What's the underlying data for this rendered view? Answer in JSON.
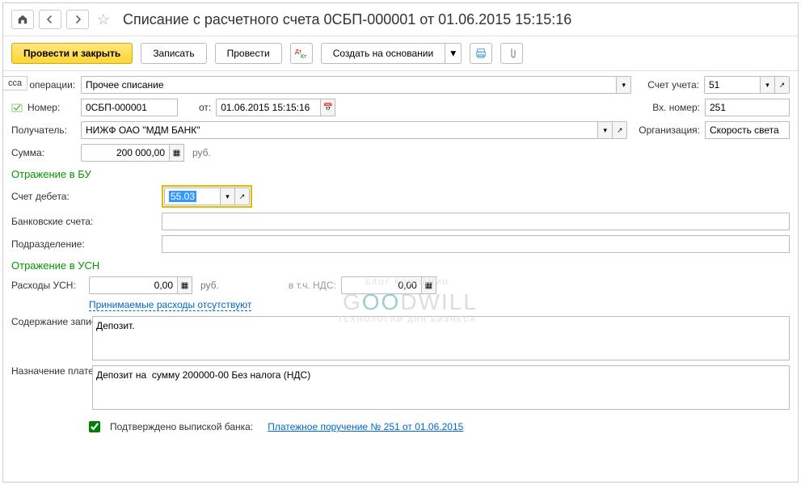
{
  "title": "Списание с расчетного счета 0СБП-000001 от 01.06.2015 15:15:16",
  "toolbar": {
    "post_close": "Провести и закрыть",
    "save": "Записать",
    "post": "Провести",
    "create_based": "Создать на основании"
  },
  "labels": {
    "op_type": "д операции:",
    "cca": "сса",
    "account": "Счет учета:",
    "number": "Номер:",
    "from": "от:",
    "in_number": "Вх. номер:",
    "recipient": "Получатель:",
    "organization": "Организация:",
    "amount": "Сумма:",
    "rub": "руб.",
    "section_bu": "Отражение в БУ",
    "debit_account": "Счет дебета:",
    "bank_accounts": "Банковские счета:",
    "subdivision": "Подразделение:",
    "section_usn": "Отражение в УСН",
    "usn_expenses": "Расходы УСН:",
    "incl_vat": "в т.ч. НДС:",
    "expenses_note": "Принимаемые расходы отсутствуют",
    "kudir_content": "Содержание записи КУДиР:",
    "payment_purpose": "Назначение платежа:",
    "confirmed": "Подтверждено выпиской банка:"
  },
  "values": {
    "op_type": "Прочее списание",
    "account": "51",
    "number": "0СБП-000001",
    "date": "01.06.2015 15:15:16",
    "in_number": "251",
    "recipient": "НИЖФ ОАО \"МДМ БАНК\"",
    "organization": "Скорость света",
    "amount": "200 000,00",
    "debit_account": "55.03",
    "usn_expenses": "0,00",
    "vat": "0,00",
    "kudir": "Депозит.",
    "purpose": "Депозит на  сумму 200000-00 Без налога (НДС)",
    "payment_link": "Платежное поручение № 251  от 01.06.2015"
  },
  "watermark": {
    "t1": "G",
    "t2": "OO",
    "t3": "DWILL",
    "sub1": "БЛОГ КОМПАНИИ",
    "sub2": "ТЕХНОЛОГИИ ДЛЯ БИЗНЕСА"
  }
}
